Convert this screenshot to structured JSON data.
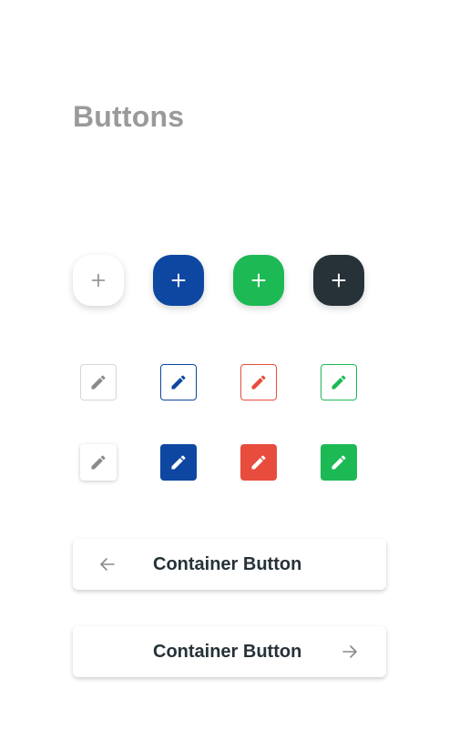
{
  "page": {
    "title": "Buttons"
  },
  "colors": {
    "primary_blue": "#0d47a1",
    "success_green": "#1db954",
    "danger_red": "#e74c3c",
    "dark": "#263238",
    "title_grey": "#9a9a9a",
    "neutral_grey": "#8a8a8a"
  },
  "fab_buttons": [
    {
      "icon": "plus-icon",
      "style": "white"
    },
    {
      "icon": "plus-icon",
      "style": "blue"
    },
    {
      "icon": "plus-icon",
      "style": "green"
    },
    {
      "icon": "plus-icon",
      "style": "dark"
    }
  ],
  "outlined_icon_buttons": [
    {
      "icon": "pencil-icon",
      "style": "grey"
    },
    {
      "icon": "pencil-icon",
      "style": "blue"
    },
    {
      "icon": "pencil-icon",
      "style": "red"
    },
    {
      "icon": "pencil-icon",
      "style": "green"
    }
  ],
  "filled_icon_buttons": [
    {
      "icon": "pencil-icon",
      "style": "white"
    },
    {
      "icon": "pencil-icon",
      "style": "blue"
    },
    {
      "icon": "pencil-icon",
      "style": "red"
    },
    {
      "icon": "pencil-icon",
      "style": "green"
    }
  ],
  "container_buttons": [
    {
      "label": "Container Button",
      "icon": "arrow-left-icon",
      "icon_position": "leading"
    },
    {
      "label": "Container Button",
      "icon": "arrow-right-icon",
      "icon_position": "trailing"
    }
  ]
}
